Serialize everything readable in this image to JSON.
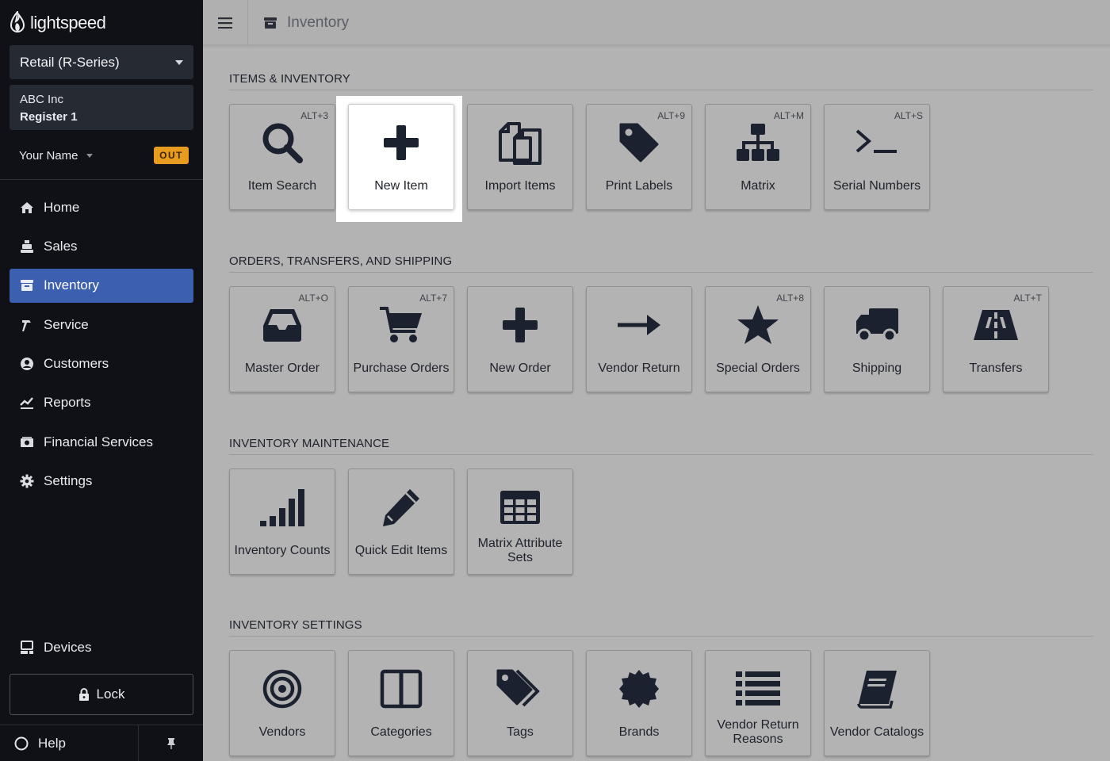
{
  "app": {
    "brand": "lightspeed"
  },
  "sidebar": {
    "account": "Retail (R-Series)",
    "company": "ABC Inc",
    "register": "Register 1",
    "user_name": "Your Name",
    "status_badge": "OUT",
    "nav": [
      {
        "label": "Home",
        "icon": "home-icon"
      },
      {
        "label": "Sales",
        "icon": "register-icon"
      },
      {
        "label": "Inventory",
        "icon": "inventory-icon",
        "active": true
      },
      {
        "label": "Service",
        "icon": "hammer-icon"
      },
      {
        "label": "Customers",
        "icon": "user-circle-icon"
      },
      {
        "label": "Reports",
        "icon": "chart-icon"
      },
      {
        "label": "Financial Services",
        "icon": "money-icon"
      },
      {
        "label": "Settings",
        "icon": "gear-icon"
      }
    ],
    "devices": "Devices",
    "lock": "Lock",
    "help": "Help"
  },
  "header": {
    "title": "Inventory"
  },
  "sections": [
    {
      "title": "ITEMS & INVENTORY",
      "tiles": [
        {
          "label": "Item Search",
          "shortcut": "ALT+3",
          "icon": "search-icon"
        },
        {
          "label": "New Item",
          "shortcut": "",
          "icon": "plus-icon",
          "focused": true
        },
        {
          "label": "Import Items",
          "shortcut": "",
          "icon": "copy-icon"
        },
        {
          "label": "Print Labels",
          "shortcut": "ALT+9",
          "icon": "tag-icon"
        },
        {
          "label": "Matrix",
          "shortcut": "ALT+M",
          "icon": "sitemap-icon"
        },
        {
          "label": "Serial Numbers",
          "shortcut": "ALT+S",
          "icon": "terminal-icon"
        }
      ]
    },
    {
      "title": "ORDERS, TRANSFERS, AND SHIPPING",
      "tiles": [
        {
          "label": "Master Order",
          "shortcut": "ALT+O",
          "icon": "inbox-icon"
        },
        {
          "label": "Purchase Orders",
          "shortcut": "ALT+7",
          "icon": "cart-icon"
        },
        {
          "label": "New Order",
          "shortcut": "",
          "icon": "plus-icon"
        },
        {
          "label": "Vendor Return",
          "shortcut": "",
          "icon": "arrow-right-icon"
        },
        {
          "label": "Special Orders",
          "shortcut": "ALT+8",
          "icon": "star-icon"
        },
        {
          "label": "Shipping",
          "shortcut": "",
          "icon": "truck-icon"
        },
        {
          "label": "Transfers",
          "shortcut": "ALT+T",
          "icon": "road-icon"
        }
      ]
    },
    {
      "title": "INVENTORY MAINTENANCE",
      "tiles": [
        {
          "label": "Inventory Counts",
          "shortcut": "",
          "icon": "signal-icon"
        },
        {
          "label": "Quick Edit Items",
          "shortcut": "",
          "icon": "pencil-icon"
        },
        {
          "label": "Matrix Attribute Sets",
          "shortcut": "",
          "icon": "table-icon"
        }
      ]
    },
    {
      "title": "INVENTORY SETTINGS",
      "tiles": [
        {
          "label": "Vendors",
          "shortcut": "",
          "icon": "bullseye-icon"
        },
        {
          "label": "Categories",
          "shortcut": "",
          "icon": "columns-icon"
        },
        {
          "label": "Tags",
          "shortcut": "",
          "icon": "tags-icon"
        },
        {
          "label": "Brands",
          "shortcut": "",
          "icon": "certificate-icon"
        },
        {
          "label": "Vendor Return Reasons",
          "shortcut": "",
          "icon": "list-icon"
        },
        {
          "label": "Vendor Catalogs",
          "shortcut": "",
          "icon": "book-icon"
        }
      ]
    }
  ]
}
